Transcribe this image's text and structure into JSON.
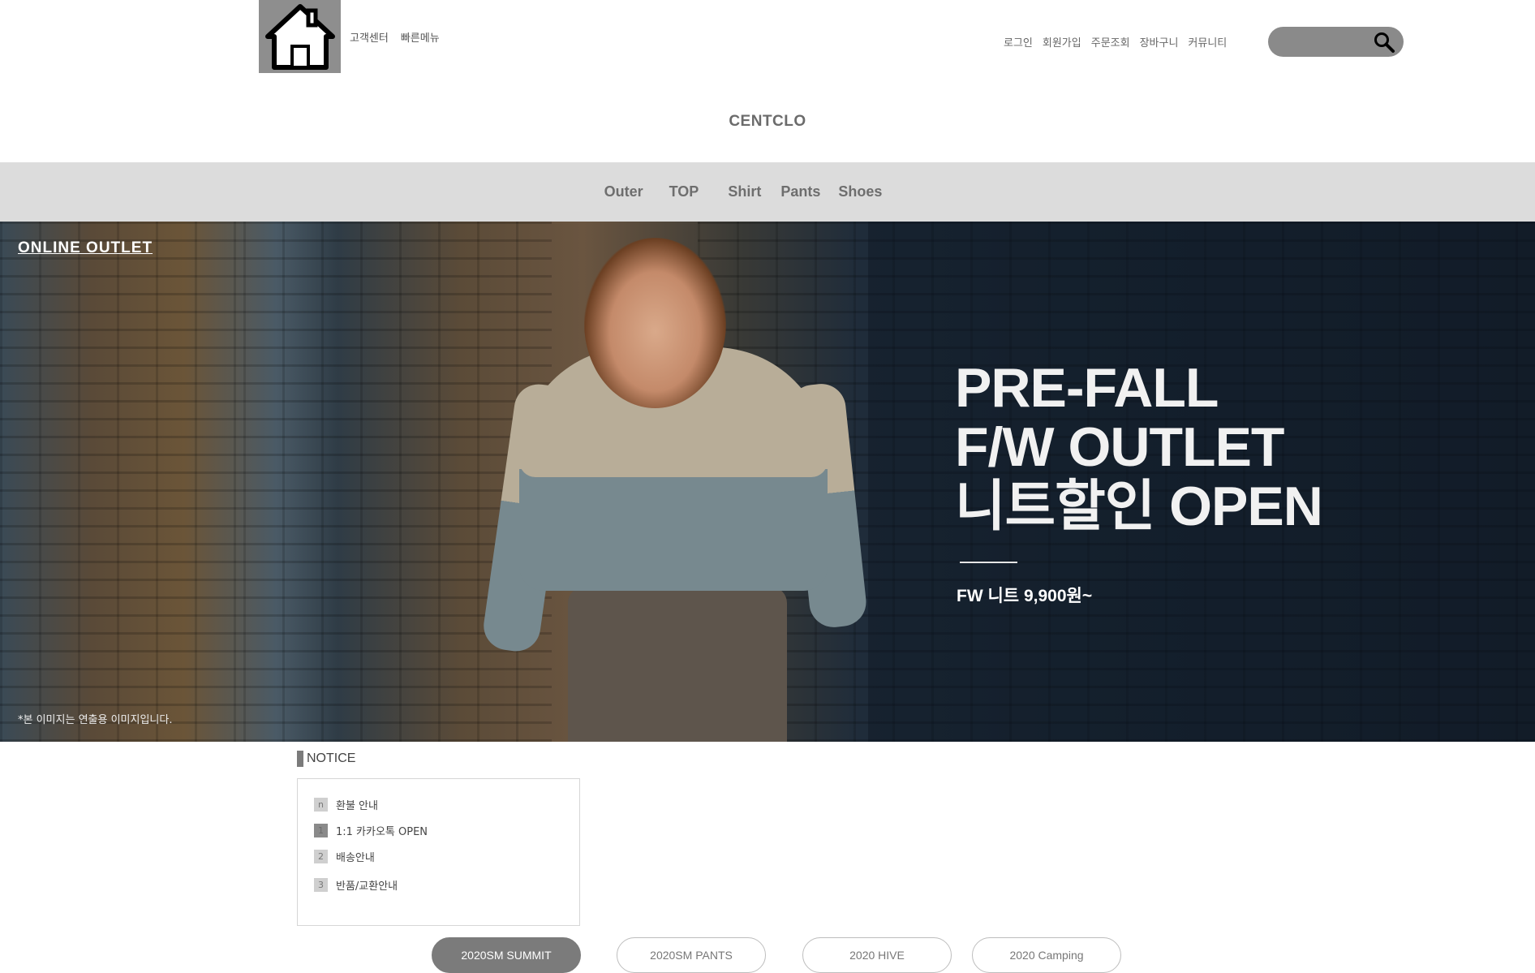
{
  "topbar": {
    "home_icon": "house-icon",
    "left_links": [
      "고객센터",
      "빠른메뉴"
    ],
    "right_links": [
      "로그인",
      "회원가입",
      "주문조회",
      "장바구니",
      "커뮤니티"
    ],
    "search": {
      "value": "",
      "icon": "search-icon"
    }
  },
  "logo": "CENTCLO",
  "nav": [
    "Outer",
    "TOP",
    "Shirt",
    "Pants",
    "Shoes"
  ],
  "banner": {
    "tag": "ONLINE OUTLET",
    "headline": [
      "PRE-FALL",
      "F/W OUTLET",
      "니트할인 OPEN"
    ],
    "subtext": "FW 니트 9,900원~",
    "disclaimer": "*본 이미지는 연출용 이미지입니다."
  },
  "notice": {
    "title": "NOTICE",
    "items": [
      {
        "badge": "n",
        "text": "환불 안내"
      },
      {
        "badge": "1",
        "text": "1:1 카카오톡 OPEN"
      },
      {
        "badge": "2",
        "text": "배송안내"
      },
      {
        "badge": "3",
        "text": "반품/교환안내"
      }
    ]
  },
  "tabs": {
    "items": [
      "2020SM SUMMIT",
      "2020SM PANTS",
      "2020 HIVE",
      "2020 Camping"
    ],
    "active": "2020SM SUMMIT"
  },
  "colors": {
    "nav_bg": "#dcdcdc",
    "home_bg": "#8e8e8e",
    "search_bg": "#8a8a8a",
    "active_tab": "#7b7b7b"
  }
}
